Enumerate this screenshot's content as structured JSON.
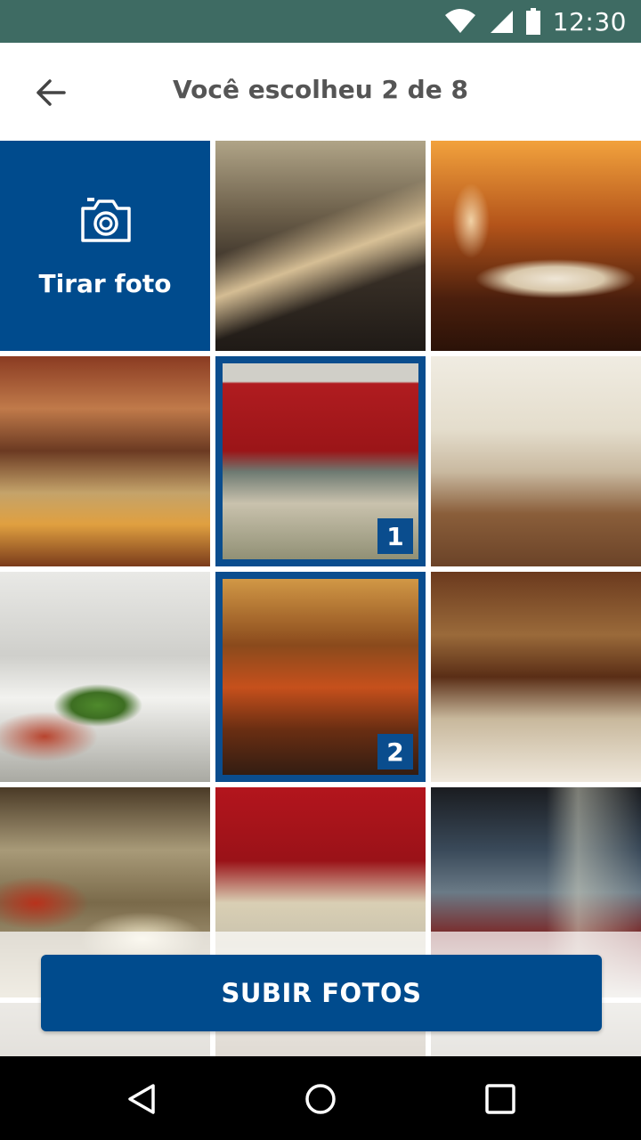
{
  "status_bar": {
    "time": "12:30",
    "icons": [
      "wifi-icon",
      "signal-icon",
      "battery-icon"
    ]
  },
  "app_bar": {
    "title": "Você escolheu 2 de 8",
    "back_icon": "arrow-left-icon"
  },
  "camera_tile": {
    "label": "Tirar foto",
    "icon": "camera-icon"
  },
  "photos": [
    {
      "name": "restaurant-tables",
      "selected": false,
      "badge": ""
    },
    {
      "name": "plated-dish-wine-glass",
      "selected": false,
      "badge": ""
    },
    {
      "name": "buffet-counter",
      "selected": false,
      "badge": ""
    },
    {
      "name": "buffet-red-wall",
      "selected": true,
      "badge": "1"
    },
    {
      "name": "bright-dining-room",
      "selected": false,
      "badge": ""
    },
    {
      "name": "salad-bowls",
      "selected": false,
      "badge": ""
    },
    {
      "name": "orange-chairs-dining",
      "selected": true,
      "badge": "2"
    },
    {
      "name": "elegant-dining-room",
      "selected": false,
      "badge": ""
    },
    {
      "name": "hot-food-trays",
      "selected": false,
      "badge": ""
    },
    {
      "name": "buffet-red-ceiling",
      "selected": false,
      "badge": ""
    },
    {
      "name": "wine-wall-dining",
      "selected": false,
      "badge": ""
    }
  ],
  "upload_button": {
    "label": "SUBIR FOTOS"
  },
  "nav_bar": {
    "icons": [
      "back-triangle-icon",
      "home-circle-icon",
      "recents-square-icon"
    ]
  },
  "colors": {
    "status_bar": "#3e6b63",
    "brand_blue": "#004b8d"
  }
}
